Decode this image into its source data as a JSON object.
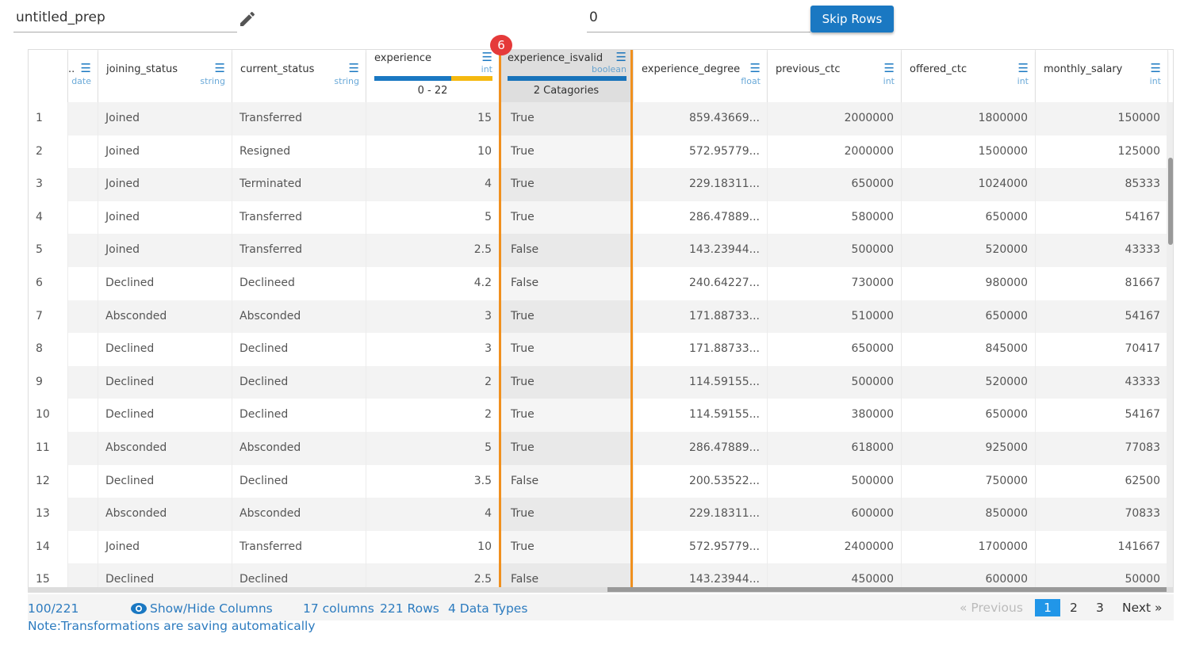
{
  "toolbar": {
    "name": "untitled_prep",
    "skip_value": "0",
    "skip_label": "Skip Rows"
  },
  "badge": "6",
  "columns": [
    {
      "name": "..",
      "type": "date"
    },
    {
      "name": "joining_status",
      "type": "string"
    },
    {
      "name": "current_status",
      "type": "string"
    },
    {
      "name": "experience",
      "type": "int",
      "summary": "0 - 22"
    },
    {
      "name": "experience_isvalid",
      "type": "boolean",
      "summary": "2 Catagories"
    },
    {
      "name": "experience_degree",
      "type": "float"
    },
    {
      "name": "previous_ctc",
      "type": "int"
    },
    {
      "name": "offered_ctc",
      "type": "int"
    },
    {
      "name": "monthly_salary",
      "type": "int"
    }
  ],
  "rows": [
    [
      "1",
      "",
      "Joined",
      "Transferred",
      "15",
      "True",
      "859.43669...",
      "2000000",
      "1800000",
      "150000"
    ],
    [
      "2",
      "",
      "Joined",
      "Resigned",
      "10",
      "True",
      "572.95779...",
      "2000000",
      "1500000",
      "125000"
    ],
    [
      "3",
      "",
      "Joined",
      "Terminated",
      "4",
      "True",
      "229.18311...",
      "650000",
      "1024000",
      "85333"
    ],
    [
      "4",
      "",
      "Joined",
      "Transferred",
      "5",
      "True",
      "286.47889...",
      "580000",
      "650000",
      "54167"
    ],
    [
      "5",
      "",
      "Joined",
      "Transferred",
      "2.5",
      "False",
      "143.23944...",
      "500000",
      "520000",
      "43333"
    ],
    [
      "6",
      "",
      "Declined",
      "Declineed",
      "4.2",
      "False",
      "240.64227...",
      "730000",
      "980000",
      "81667"
    ],
    [
      "7",
      "",
      "Absconded",
      "Absconded",
      "3",
      "True",
      "171.88733...",
      "510000",
      "650000",
      "54167"
    ],
    [
      "8",
      "",
      "Declined",
      "Declined",
      "3",
      "True",
      "171.88733...",
      "650000",
      "845000",
      "70417"
    ],
    [
      "9",
      "",
      "Declined",
      "Declined",
      "2",
      "True",
      "114.59155...",
      "500000",
      "520000",
      "43333"
    ],
    [
      "10",
      "",
      "Declined",
      "Declined",
      "2",
      "True",
      "114.59155...",
      "380000",
      "650000",
      "54167"
    ],
    [
      "11",
      "",
      "Absconded",
      "Absconded",
      "5",
      "True",
      "286.47889...",
      "618000",
      "925000",
      "77083"
    ],
    [
      "12",
      "",
      "Declined",
      "Declined",
      "3.5",
      "False",
      "200.53522...",
      "500000",
      "750000",
      "62500"
    ],
    [
      "13",
      "",
      "Absconded",
      "Absconded",
      "4",
      "True",
      "229.18311...",
      "600000",
      "850000",
      "70833"
    ],
    [
      "14",
      "",
      "Joined",
      "Transferred",
      "10",
      "True",
      "572.95779...",
      "2400000",
      "1700000",
      "141667"
    ],
    [
      "15",
      "",
      "Declined",
      "Declined",
      "2.5",
      "False",
      "143.23944...",
      "450000",
      "600000",
      "50000"
    ]
  ],
  "footer": {
    "count": "100/221",
    "show_hide": "Show/Hide Columns",
    "columns": "17 columns",
    "rows": "221 Rows",
    "types": "4 Data Types",
    "previous": "Previous",
    "pages": [
      "1",
      "2",
      "3"
    ],
    "next": "Next",
    "note": "Note:Transformations are saving automatically"
  },
  "colors": {
    "accent": "#1a78c2",
    "highlight": "#f0901e",
    "badge": "#e53a3a"
  }
}
